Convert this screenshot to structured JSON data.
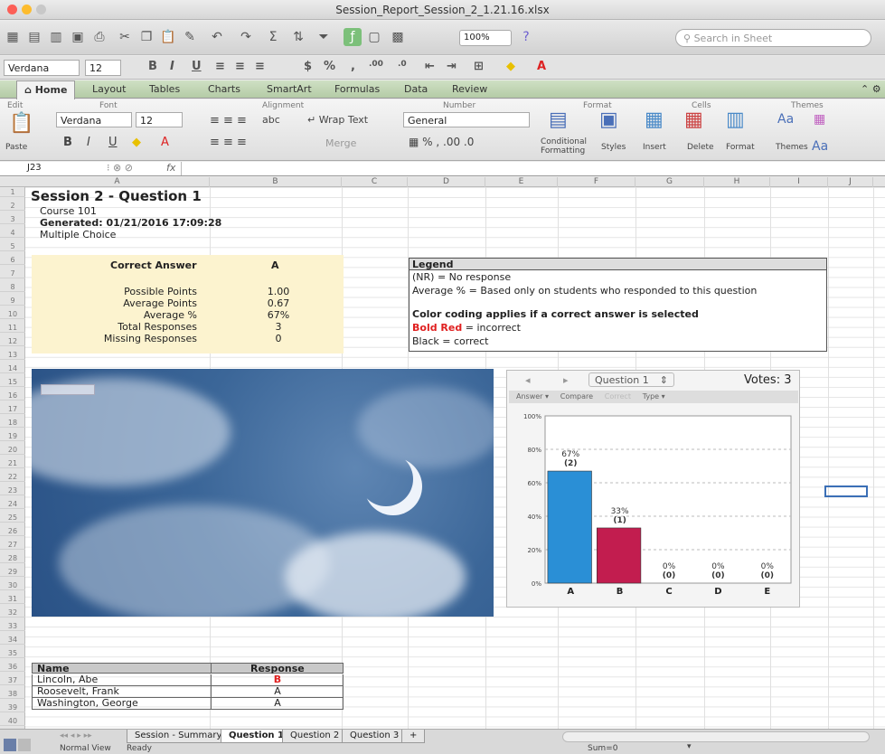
{
  "window": {
    "title": "Session_Report_Session_2_1.21.16.xlsx"
  },
  "toolbar": {
    "zoom": "100%",
    "search_placeholder": "Search in Sheet"
  },
  "format_bar": {
    "font": "Verdana",
    "size": "12"
  },
  "ribbon": {
    "tabs": [
      "Home",
      "Layout",
      "Tables",
      "Charts",
      "SmartArt",
      "Formulas",
      "Data",
      "Review"
    ],
    "groups": [
      "Edit",
      "Font",
      "Alignment",
      "Number",
      "Format",
      "Cells",
      "Themes"
    ],
    "font_name": "Verdana",
    "font_size": "12",
    "wrap_text": "Wrap Text",
    "abc": "abc",
    "merge": "Merge",
    "number_format": "General",
    "paste": "Paste",
    "conditional_formatting": "Conditional Formatting",
    "styles": "Styles",
    "insert": "Insert",
    "delete": "Delete",
    "format": "Format",
    "themes": "Themes"
  },
  "formula_bar": {
    "cell_ref": "J23",
    "fx": "fx"
  },
  "columns": [
    "A",
    "B",
    "C",
    "D",
    "E",
    "F",
    "G",
    "H",
    "I",
    "J"
  ],
  "rows": [
    "1",
    "2",
    "3",
    "4",
    "5",
    "6",
    "7",
    "8",
    "9",
    "10",
    "11",
    "12",
    "13",
    "14",
    "15",
    "16",
    "17",
    "18",
    "19",
    "20",
    "21",
    "22",
    "23",
    "24",
    "25",
    "26",
    "27",
    "28",
    "29",
    "30",
    "31",
    "32",
    "33",
    "34",
    "35",
    "36",
    "37",
    "38",
    "39",
    "40"
  ],
  "sheet": {
    "title": "Session 2 - Question 1",
    "course": "Course 101",
    "generated": "Generated: 01/21/2016 17:09:28",
    "qtype": "Multiple Choice",
    "correct_answer_label": "Correct Answer",
    "correct_answer_value": "A",
    "stats": [
      {
        "label": "Possible Points",
        "value": "1.00"
      },
      {
        "label": "Average Points",
        "value": "0.67"
      },
      {
        "label": "Average %",
        "value": "67%"
      },
      {
        "label": "Total Responses",
        "value": "3"
      },
      {
        "label": "Missing Responses",
        "value": "0"
      }
    ],
    "legend": {
      "title": "Legend",
      "nr": "(NR) = No response",
      "avg": "Average % = Based only on students who responded to this question",
      "color_coding": "Color coding applies if a correct answer is selected",
      "bold_red": "Bold Red",
      "incorrect": " = incorrect",
      "black": "Black = correct"
    },
    "table": {
      "headers": [
        "Name",
        "Response"
      ],
      "rows": [
        {
          "name": "Lincoln, Abe",
          "response": "B",
          "incorrect": true
        },
        {
          "name": "Roosevelt, Frank",
          "response": "A",
          "incorrect": false
        },
        {
          "name": "Washington, George",
          "response": "A",
          "incorrect": false
        }
      ]
    }
  },
  "chart_panel": {
    "question_select": "Question 1",
    "votes": "Votes: 3",
    "menu": [
      "Answer ▾",
      "Compare",
      "Correct",
      "Type ▾"
    ]
  },
  "chart_data": {
    "type": "bar",
    "categories": [
      "A",
      "B",
      "C",
      "D",
      "E"
    ],
    "values": [
      67,
      33,
      0,
      0,
      0
    ],
    "value_labels": [
      "67%",
      "33%",
      "0%",
      "0%",
      "0%"
    ],
    "count_labels": [
      "(2)",
      "(1)",
      "(0)",
      "(0)",
      "(0)"
    ],
    "colors": [
      "#2a8fd6",
      "#c21d4f",
      "#999999",
      "#999999",
      "#999999"
    ],
    "yticks": [
      "0%",
      "20%",
      "40%",
      "60%",
      "80%",
      "100%"
    ],
    "ylim": [
      0,
      100
    ],
    "grid": true
  },
  "sheet_tabs": [
    "Session - Summary",
    "Question 1",
    "Question 2",
    "Question 3",
    "+"
  ],
  "status": {
    "view": "Normal View",
    "state": "Ready",
    "sum": "Sum=0"
  }
}
